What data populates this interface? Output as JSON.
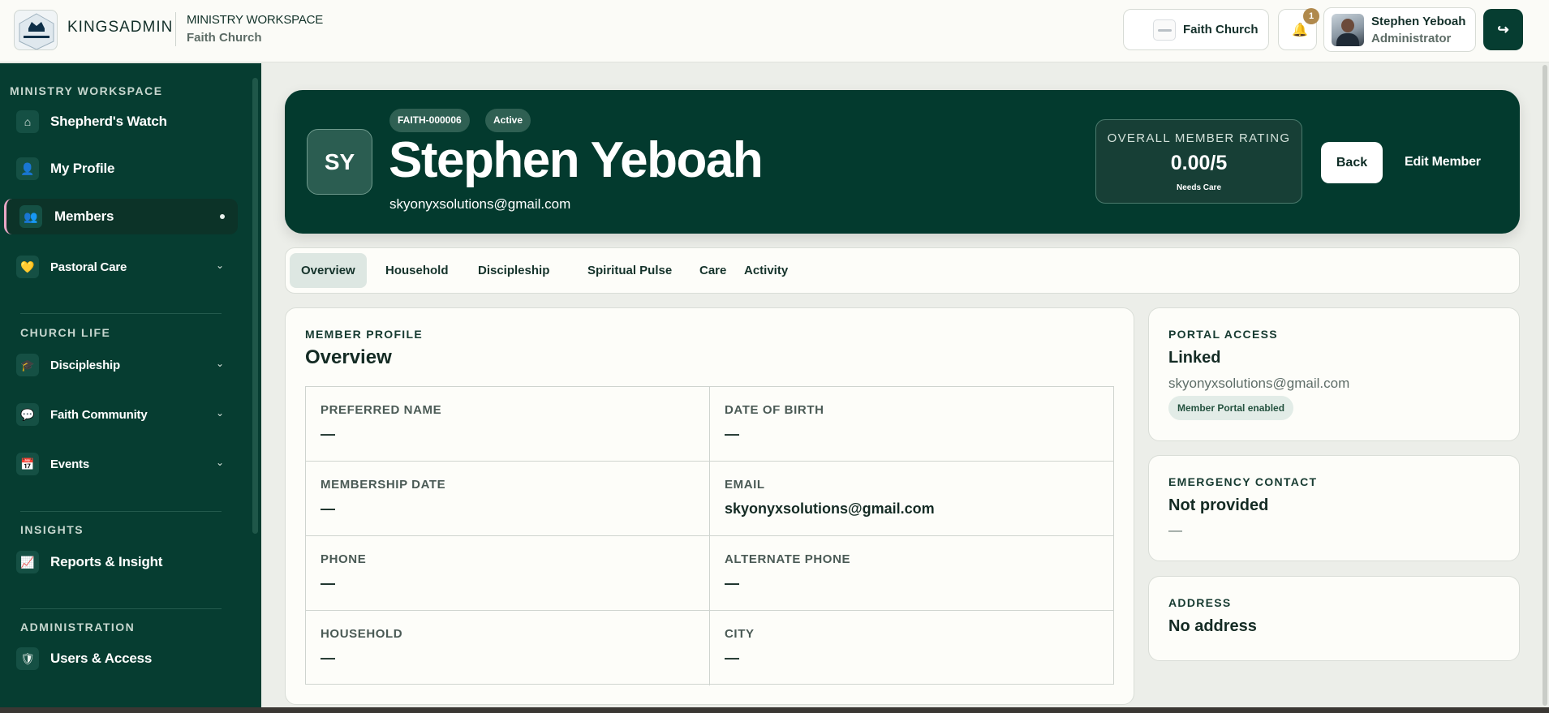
{
  "topbar": {
    "logo_text": "KINGSADMIN",
    "brand": "KINGSADMIN",
    "workspace_title": "MINISTRY WORKSPACE",
    "workspace_subtitle": "Faith Church",
    "church_selector": "Faith Church",
    "notification_count": "1",
    "user_name": "Stephen Yeboah",
    "user_role": "Administrator",
    "logout_icon": "logout-icon"
  },
  "sidebar": {
    "sections": [
      {
        "heading": "MINISTRY WORKSPACE"
      },
      {
        "heading": "CHURCH LIFE"
      },
      {
        "heading": "INSIGHTS"
      },
      {
        "heading": "ADMINISTRATION"
      }
    ],
    "items": [
      {
        "label": "Shepherd's Watch",
        "icon": "home-icon",
        "glyph": "⌂"
      },
      {
        "label": "My Profile",
        "icon": "person-icon",
        "glyph": "👤"
      },
      {
        "label": "Members",
        "icon": "group-icon",
        "glyph": "👥"
      },
      {
        "label": "Pastoral Care",
        "icon": "heart-hands-icon",
        "glyph": "💛",
        "chevron": "⌄"
      },
      {
        "label": "Discipleship",
        "icon": "graduation-cap-icon",
        "glyph": "🎓",
        "chevron": "⌄"
      },
      {
        "label": "Faith Community",
        "icon": "chat-bubble-icon",
        "glyph": "💬",
        "chevron": "⌄"
      },
      {
        "label": "Events",
        "icon": "calendar-icon",
        "glyph": "📅",
        "chevron": "⌄"
      },
      {
        "label": "Reports & Insight",
        "icon": "chart-icon",
        "glyph": "📈"
      },
      {
        "label": "Users & Access",
        "icon": "shield-icon",
        "glyph": "🛡"
      }
    ]
  },
  "hero": {
    "initials": "SY",
    "member_id": "FAITH-000006",
    "status": "Active",
    "name": "Stephen Yeboah",
    "email": "skyonyxsolutions@gmail.com",
    "rating_label": "OVERALL MEMBER RATING",
    "rating_value": "0.00/5",
    "rating_status": "Needs Care",
    "back_label": "Back",
    "edit_label": "Edit Member"
  },
  "tabs": [
    "Overview",
    "Household",
    "Discipleship",
    "Spiritual Pulse",
    "Care",
    "Activity"
  ],
  "overview": {
    "eyebrow": "MEMBER PROFILE",
    "title": "Overview",
    "fields": [
      {
        "label": "PREFERRED NAME",
        "value": "—"
      },
      {
        "label": "DATE OF BIRTH",
        "value": "—"
      },
      {
        "label": "MEMBERSHIP DATE",
        "value": "—"
      },
      {
        "label": "EMAIL",
        "value": "skyonyxsolutions@gmail.com"
      },
      {
        "label": "PHONE",
        "value": "—"
      },
      {
        "label": "ALTERNATE PHONE",
        "value": "—"
      },
      {
        "label": "HOUSEHOLD",
        "value": "—"
      },
      {
        "label": "CITY",
        "value": "—"
      }
    ]
  },
  "portal": {
    "eyebrow": "PORTAL ACCESS",
    "status": "Linked",
    "email": "skyonyxsolutions@gmail.com",
    "chip": "Member Portal enabled"
  },
  "emergency": {
    "eyebrow": "EMERGENCY CONTACT",
    "status": "Not provided",
    "value": "—"
  },
  "address": {
    "eyebrow": "ADDRESS",
    "status": "No address"
  },
  "colors": {
    "brand_dark_green": "#033a2e",
    "sidebar_green": "#063d31",
    "accent_pink": "#e9a7c6",
    "page_bg": "#eceee9"
  }
}
